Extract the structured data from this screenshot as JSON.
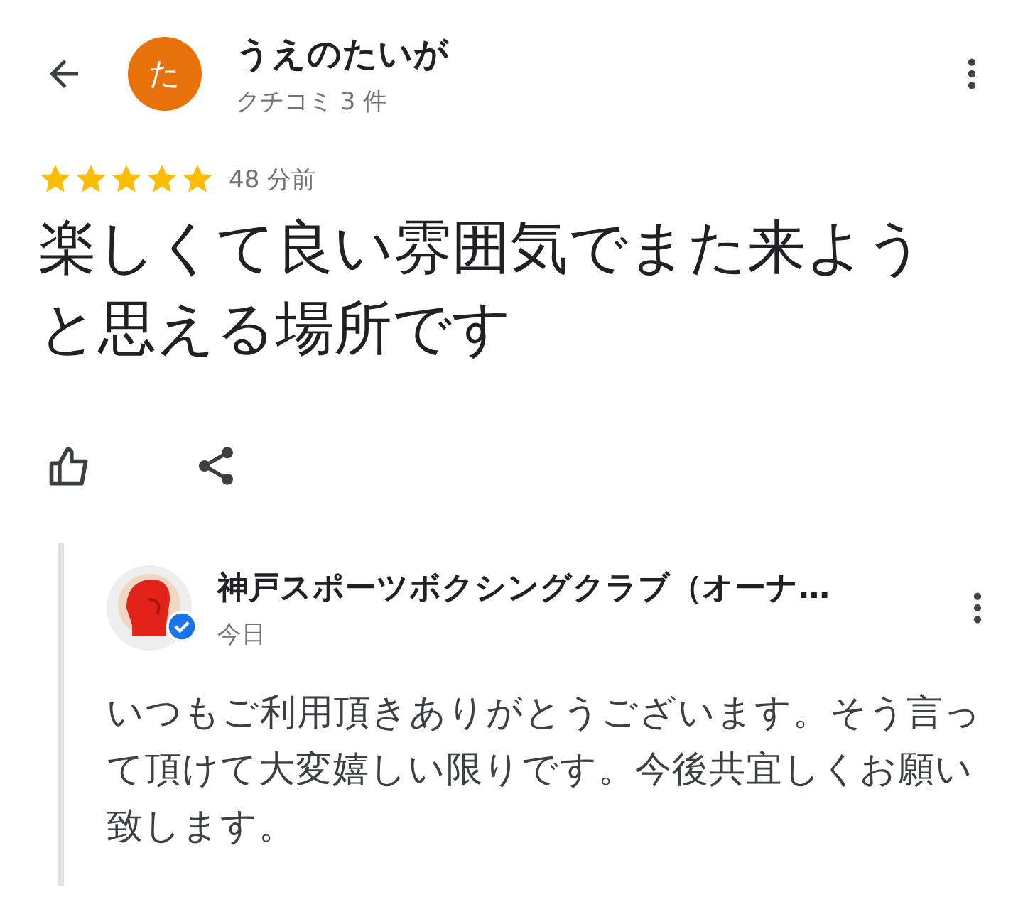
{
  "reviewer": {
    "initial": "た",
    "name": "うえのたいが",
    "review_count": "クチコミ 3 件"
  },
  "review": {
    "stars": 5,
    "time": "48 分前",
    "text": "楽しくて良い雰囲気でまた来ようと思える場所です"
  },
  "owner_reply": {
    "name": "神戸スポーツボクシングクラブ（オーナ…",
    "verified": true,
    "time": "今日",
    "text": "いつもご利用頂きありがとうございます。そう言って頂けて大変嬉しい限りです。今後共宜しくお願い致します。"
  }
}
